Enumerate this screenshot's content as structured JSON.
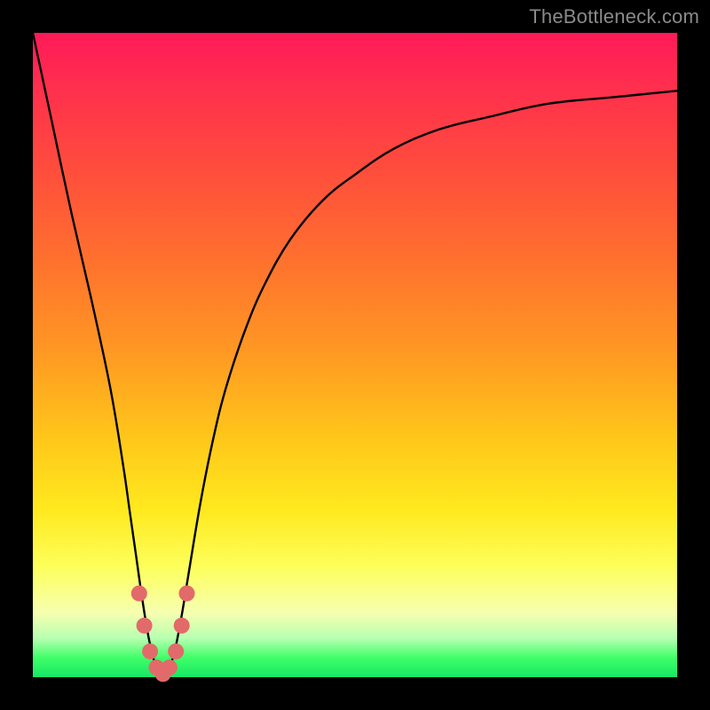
{
  "watermark": {
    "text": "TheBottleneck.com"
  },
  "colors": {
    "frame": "#000000",
    "curve": "#000000",
    "dots": "#e26a6a",
    "gradient_top": "#ff1a58",
    "gradient_bottom": "#16e764"
  },
  "chart_data": {
    "type": "line",
    "title": "",
    "xlabel": "",
    "ylabel": "",
    "xlim": [
      0,
      100
    ],
    "ylim": [
      0,
      100
    ],
    "grid": false,
    "legend": false,
    "annotations": [],
    "series": [
      {
        "name": "bottleneck-curve",
        "x": [
          0,
          3,
          6,
          9,
          12,
          14,
          15,
          16,
          17,
          18,
          19,
          20,
          21,
          22,
          23,
          24,
          26,
          28,
          30,
          33,
          36,
          40,
          45,
          50,
          56,
          63,
          71,
          80,
          90,
          100
        ],
        "y": [
          100,
          86,
          72,
          59,
          45,
          33,
          26,
          19,
          12,
          6,
          2,
          0,
          1,
          4,
          9,
          15,
          27,
          37,
          45,
          54,
          61,
          68,
          74,
          78,
          82,
          85,
          87,
          89,
          90,
          91
        ]
      }
    ],
    "markers": [
      {
        "name": "trough-dots",
        "color": "#e26a6a",
        "points": [
          {
            "x": 16.5,
            "y": 13
          },
          {
            "x": 17.3,
            "y": 8
          },
          {
            "x": 18.2,
            "y": 4
          },
          {
            "x": 19.2,
            "y": 1.5
          },
          {
            "x": 20.2,
            "y": 0.5
          },
          {
            "x": 21.2,
            "y": 1.5
          },
          {
            "x": 22.2,
            "y": 4
          },
          {
            "x": 23.1,
            "y": 8
          },
          {
            "x": 23.9,
            "y": 13
          }
        ]
      }
    ]
  }
}
